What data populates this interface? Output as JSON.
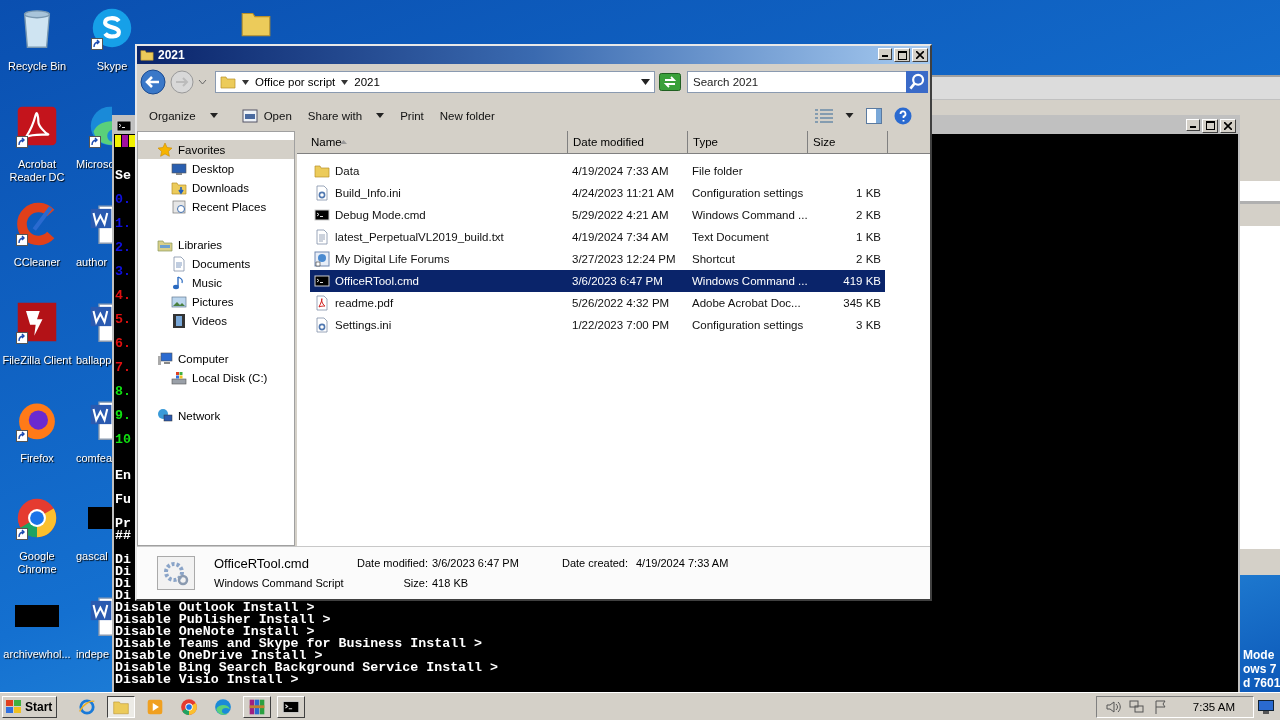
{
  "desktop": {
    "icons_left": [
      {
        "label": "Recycle Bin",
        "kind": "recycle",
        "shortcut": false
      },
      {
        "label": "Acrobat Reader DC",
        "kind": "acrobat",
        "shortcut": true
      },
      {
        "label": "CCleaner",
        "kind": "ccleaner",
        "shortcut": true
      },
      {
        "label": "FileZilla Client",
        "kind": "filezilla",
        "shortcut": true
      },
      {
        "label": "Firefox",
        "kind": "firefox",
        "shortcut": true
      },
      {
        "label": "Google Chrome",
        "kind": "chrome",
        "shortcut": true
      },
      {
        "label": "archivewhol...",
        "kind": "blank",
        "shortcut": false
      }
    ],
    "icons_right": [
      {
        "label": "Skype",
        "kind": "skype",
        "shortcut": true
      },
      {
        "label": "Microso",
        "kind": "edge",
        "shortcut": true
      },
      {
        "label": "author",
        "kind": "word",
        "shortcut": false
      },
      {
        "label": "ballapp",
        "kind": "word",
        "shortcut": false
      },
      {
        "label": "comfea",
        "kind": "word",
        "shortcut": false
      },
      {
        "label": "gascal",
        "kind": "blank",
        "shortcut": false
      },
      {
        "label": "indepe",
        "kind": "word",
        "shortcut": false
      }
    ],
    "watermark_lines": [
      "Mode",
      "ows 7",
      "d 7601"
    ]
  },
  "console": {
    "left_lines": [
      {
        "text": "Se",
        "color": "#ffffff"
      },
      {
        "text": "0.",
        "color": "#1010e0"
      },
      {
        "text": "1.",
        "color": "#1010e0"
      },
      {
        "text": "2.",
        "color": "#1010e0"
      },
      {
        "text": "3.",
        "color": "#1010e0"
      },
      {
        "text": "4.",
        "color": "#e01010"
      },
      {
        "text": "5.",
        "color": "#e01010"
      },
      {
        "text": "6.",
        "color": "#e01010"
      },
      {
        "text": "7.",
        "color": "#e01010"
      },
      {
        "text": "8.",
        "color": "#10e010"
      },
      {
        "text": "9.",
        "color": "#10e010"
      },
      {
        "text": "10",
        "color": "#10e010"
      },
      {
        "text": "En",
        "color": "#ffffff"
      },
      {
        "text": "Fu",
        "color": "#ffffff"
      },
      {
        "text": "Pr",
        "color": "#ffffff"
      },
      {
        "text": "##",
        "color": "#ffffff"
      },
      {
        "text": "Di",
        "color": "#ffffff"
      },
      {
        "text": "Di",
        "color": "#ffffff"
      },
      {
        "text": "Di",
        "color": "#ffffff"
      },
      {
        "text": "Di",
        "color": "#ffffff"
      }
    ],
    "lines": [
      "Disable Outlook Install >",
      "Disable Publisher Install >",
      "Disable OneNote Install >",
      "Disable Teams and Skype for Business Install >",
      "Disable OneDrive Install >",
      "Disable Bing Search Background Service Install >",
      "Disable Visio Install >"
    ]
  },
  "explorer": {
    "title": "2021",
    "breadcrumb": [
      "Office por script",
      "2021"
    ],
    "search": {
      "placeholder": "Search 2021"
    },
    "toolbar": [
      {
        "label": "Organize",
        "kind": "menu"
      },
      {
        "label": "Open",
        "kind": "icon"
      },
      {
        "label": "Share with",
        "kind": "menu"
      },
      {
        "label": "Print",
        "kind": "plain"
      },
      {
        "label": "New folder",
        "kind": "plain"
      }
    ],
    "nav": [
      {
        "label": "Favorites",
        "kind": "star",
        "selected": true,
        "children": [
          {
            "label": "Desktop",
            "kind": "desktop",
            "selected": false
          },
          {
            "label": "Downloads",
            "kind": "downloads",
            "selected": false
          },
          {
            "label": "Recent Places",
            "kind": "recent",
            "selected": false
          }
        ]
      },
      {
        "label": "Libraries",
        "kind": "library",
        "selected": false,
        "children": [
          {
            "label": "Documents",
            "kind": "documents",
            "selected": false
          },
          {
            "label": "Music",
            "kind": "music",
            "selected": false
          },
          {
            "label": "Pictures",
            "kind": "pictures",
            "selected": false
          },
          {
            "label": "Videos",
            "kind": "video",
            "selected": false
          }
        ]
      },
      {
        "label": "Computer",
        "kind": "computer",
        "selected": false,
        "children": [
          {
            "label": "Local Disk (C:)",
            "kind": "disk",
            "selected": false
          }
        ]
      },
      {
        "label": "Network",
        "kind": "network",
        "selected": false
      }
    ],
    "columns": [
      {
        "label": "Name",
        "sorted": true
      },
      {
        "label": "Date modified",
        "sorted": false
      },
      {
        "label": "Type",
        "sorted": false
      },
      {
        "label": "Size",
        "sorted": false
      }
    ],
    "rows": [
      {
        "name": "Data",
        "date": "4/19/2024 7:33 AM",
        "type": "File folder",
        "size": "",
        "kind": "folder",
        "selected": false
      },
      {
        "name": "Build_Info.ini",
        "date": "4/24/2023 11:21 AM",
        "type": "Configuration settings",
        "size": "1 KB",
        "kind": "ini",
        "selected": false
      },
      {
        "name": "Debug Mode.cmd",
        "date": "5/29/2022 4:21 AM",
        "type": "Windows Command ...",
        "size": "2 KB",
        "kind": "cmd",
        "selected": false
      },
      {
        "name": "latest_PerpetualVL2019_build.txt",
        "date": "4/19/2024 7:34 AM",
        "type": "Text Document",
        "size": "1 KB",
        "kind": "txt",
        "selected": false
      },
      {
        "name": "My Digital Life Forums",
        "date": "3/27/2023 12:24 PM",
        "type": "Shortcut",
        "size": "2 KB",
        "kind": "shortcut",
        "selected": false
      },
      {
        "name": "OfficeRTool.cmd",
        "date": "3/6/2023 6:47 PM",
        "type": "Windows Command ...",
        "size": "419 KB",
        "kind": "cmd",
        "selected": true
      },
      {
        "name": "readme.pdf",
        "date": "5/26/2022 4:32 PM",
        "type": "Adobe Acrobat Doc...",
        "size": "345 KB",
        "kind": "pdf",
        "selected": false
      },
      {
        "name": "Settings.ini",
        "date": "1/22/2023 7:00 PM",
        "type": "Configuration settings",
        "size": "3 KB",
        "kind": "ini",
        "selected": false
      }
    ],
    "details": {
      "name": "OfficeRTool.cmd",
      "type": "Windows Command Script",
      "modified": {
        "label": "Date modified:",
        "value": "3/6/2023 6:47 PM"
      },
      "size": {
        "label": "Size:",
        "value": "418 KB"
      },
      "created": {
        "label": "Date created:",
        "value": "4/19/2024 7:33 AM"
      }
    }
  },
  "taskbar": {
    "start": "Start",
    "apps": [
      {
        "kind": "ie",
        "selected": false
      },
      {
        "kind": "explorer",
        "selected": true
      },
      {
        "kind": "media",
        "selected": false
      },
      {
        "kind": "chrome",
        "selected": false
      },
      {
        "kind": "edge",
        "selected": false
      },
      {
        "kind": "winrar",
        "selected": false
      },
      {
        "kind": "cmd",
        "selected": false
      }
    ],
    "time": "7:35 AM"
  }
}
